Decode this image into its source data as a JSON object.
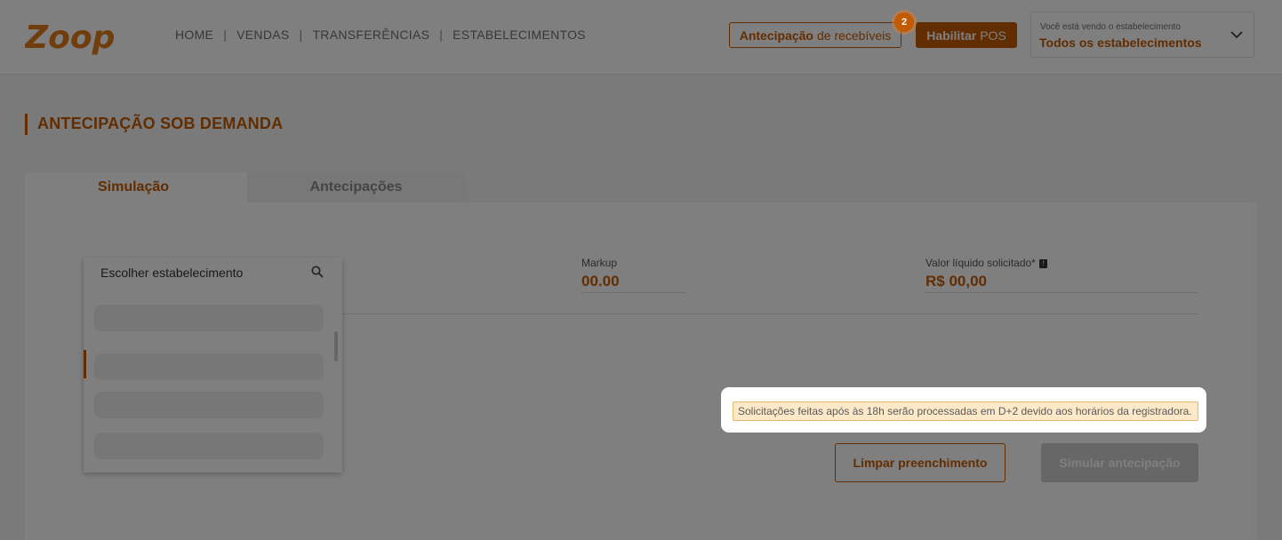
{
  "header": {
    "logo_text": "Zoop",
    "nav": [
      "HOME",
      "VENDAS",
      "TRANSFERÊNCIAS",
      "ESTABELECIMENTOS"
    ],
    "antecipacao_bold": "Antecipação",
    "antecipacao_rest": "de recebíveis",
    "notification_count": "2",
    "habilitar_bold": "Habilitar",
    "habilitar_rest": "POS",
    "estab_caption": "Você está vendo o estabelecimento",
    "estab_value": "Todos os estabelecimentos"
  },
  "page": {
    "title": "ANTECIPAÇÃO SOB DEMANDA",
    "tabs": [
      "Simulação",
      "Antecipações"
    ]
  },
  "form": {
    "markup_label": "Markup",
    "markup_value": "00.00",
    "valor_label": "Valor líquido solicitado*",
    "valor_value": "R$ 00,00"
  },
  "dropdown": {
    "search_placeholder": "Escolher estabelecimento"
  },
  "notice": "Solicitações feitas após às 18h serão processadas em D+2 devido aos horários da registradora.",
  "buttons": {
    "clear": "Limpar preenchimento",
    "simulate": "Simular antecipação"
  },
  "colors": {
    "brand": "#c45a00",
    "notice_bg": "#fde9c8",
    "overlay": "rgba(0,0,0,0.5)"
  },
  "icons": {
    "search": "search-icon",
    "chevron": "chevron-down-icon",
    "info": "info-icon"
  }
}
